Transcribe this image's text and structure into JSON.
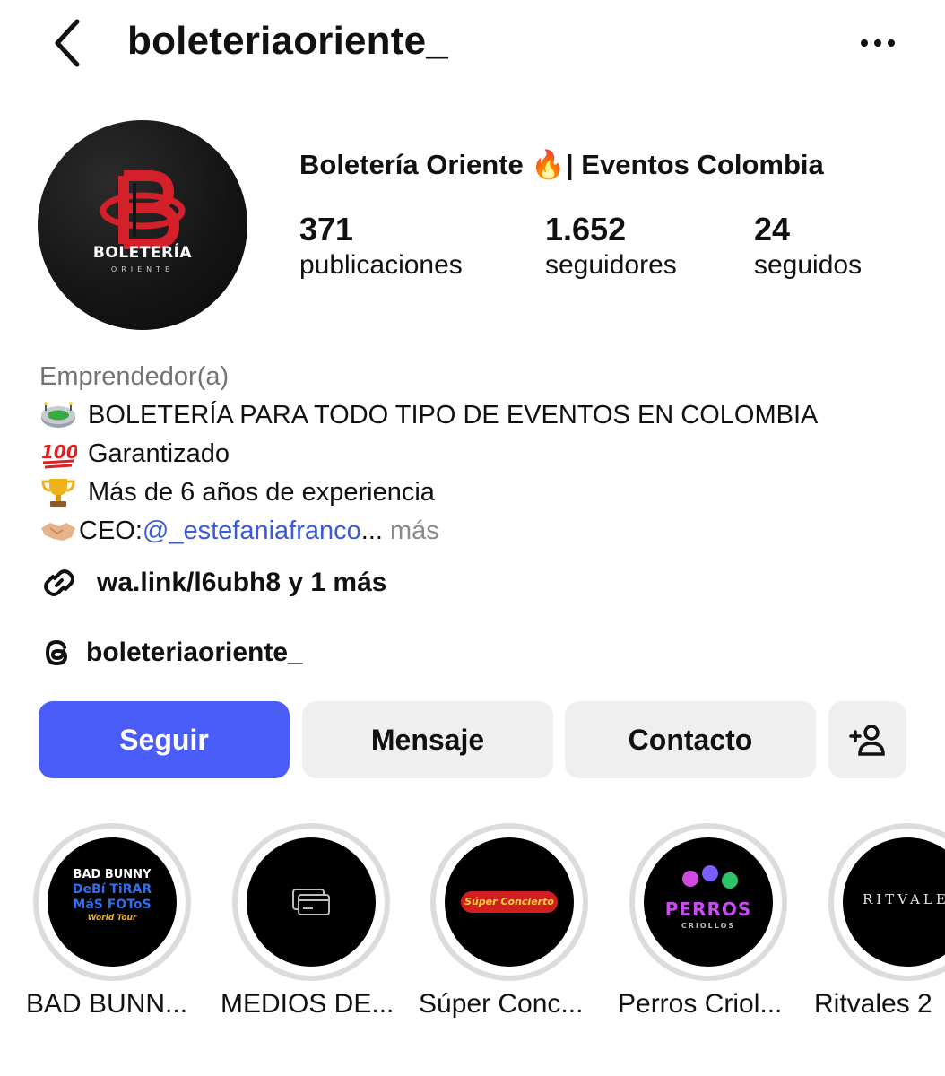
{
  "header": {
    "username": "boleteriaoriente_"
  },
  "profile": {
    "avatar_text": "BOLETERÍA",
    "avatar_subtext": "ORIENTE",
    "full_name": "Boletería Oriente 🔥| Eventos Colombia",
    "stats": [
      {
        "value": "371",
        "label": "publicaciones"
      },
      {
        "value": "1.652",
        "label": "seguidores"
      },
      {
        "value": "24",
        "label": "seguidos"
      }
    ],
    "category": "Emprendedor(a)",
    "bio": {
      "line1": "BOLETERÍA PARA TODO TIPO DE EVENTOS EN COLOMBIA",
      "line2": "Garantizado",
      "line3": "Más de 6 años de experiencia",
      "line4_prefix": "CEO: ",
      "line4_mention": "@_estefaniafranco",
      "line4_ellipsis": "... ",
      "line4_more": "más"
    },
    "link": "wa.link/l6ubh8 y 1 más",
    "threads": "boleteriaoriente_"
  },
  "actions": {
    "follow": "Seguir",
    "message": "Mensaje",
    "contact": "Contacto"
  },
  "highlights": [
    {
      "label": "BAD BUNN...",
      "art_lines": [
        "BAD BUNNY",
        "DeBí TiRAR",
        "MáS FOToS",
        "World Tour"
      ]
    },
    {
      "label": "MEDIOS DE..."
    },
    {
      "label": "Súper Conc...",
      "art_text": "Súper Concierto"
    },
    {
      "label": "Perros Criol...",
      "art_text": "PERROS",
      "art_sub": "CRIOLLOS"
    },
    {
      "label": "Ritvales 2",
      "art_text": "RITVALE"
    }
  ],
  "colors": {
    "primary_button": "#4a5df9",
    "mention": "#3a5bd8",
    "secondary_button": "#efefef",
    "brand_red": "#d3202a"
  },
  "icons": {
    "back": "chevron-left-icon",
    "more": "more-horizontal-icon",
    "link": "link-icon",
    "threads": "threads-icon",
    "add_user": "add-user-icon"
  }
}
